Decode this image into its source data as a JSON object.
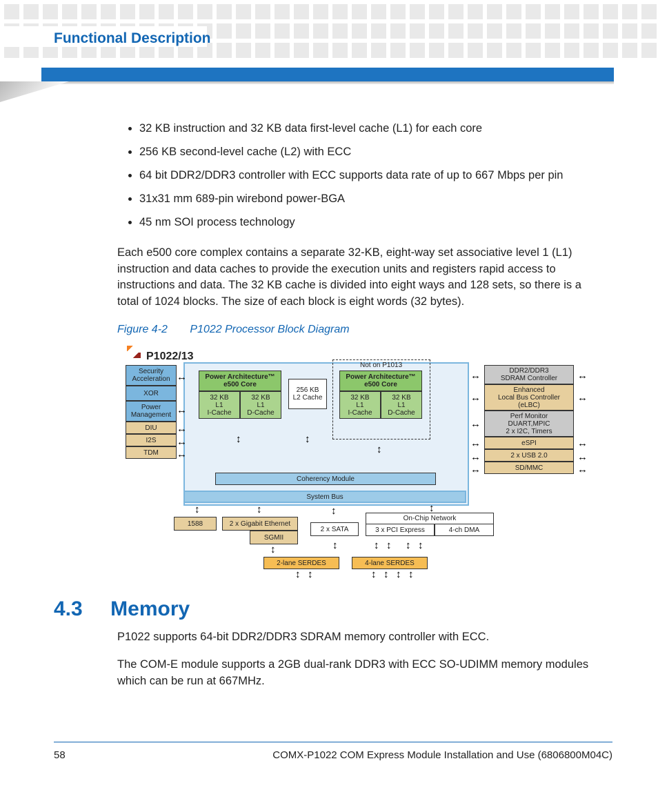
{
  "header": {
    "chapter_title": "Functional Description"
  },
  "bullets": [
    "32 KB instruction and 32 KB data first-level cache (L1) for each core",
    "256 KB second-level cache (L2) with ECC",
    "64 bit DDR2/DDR3 controller with ECC supports data rate of up to 667 Mbps per pin",
    "31x31 mm 689-pin wirebond power-BGA",
    "45 nm SOI process technology"
  ],
  "paragraph1": "Each e500 core complex contains a separate 32-KB, eight-way set associative level 1 (L1) instruction and data caches to provide the execution units and registers rapid access to instructions and data. The 32 KB cache is divided into eight ways and 128 sets, so there is a total of 1024 blocks. The size of each block is eight words (32 bytes).",
  "figure": {
    "num": "Figure 4-2",
    "caption": "P1022 Processor Block Diagram"
  },
  "diagram": {
    "chip": "P1022/13",
    "left_blocks": [
      "Security\nAcceleration",
      "XOR",
      "Power\nManagement",
      "DIU",
      "I2S",
      "TDM"
    ],
    "core_title": "Power Architecture™\ne500 Core",
    "icache": "32 KB\nL1\nI-Cache",
    "dcache": "32 KB\nL1\nD-Cache",
    "l2": "256 KB\nL2 Cache",
    "not_on": "Not on P1013",
    "coherency": "Coherency Module",
    "system_bus": "System Bus",
    "right_blocks": [
      "DDR2/DDR3\nSDRAM Controller",
      "Enhanced\nLocal Bus Controller\n(eLBC)",
      "Perf Monitor\nDUART,MPIC\n2 x I2C, Timers",
      "eSPI",
      "2 x USB 2.0",
      "SD/MMC"
    ],
    "bottom_tan": [
      "1588",
      "2 x Gigabit Ethernet",
      "SGMII"
    ],
    "bottom_white": [
      "2 x SATA",
      "3 x PCI Express",
      "4-ch DMA"
    ],
    "onchip": "On-Chip Network",
    "serdes2": "2-lane SERDES",
    "serdes4": "4-lane SERDES"
  },
  "section": {
    "num": "4.3",
    "title": "Memory"
  },
  "paragraph2": "P1022 supports 64-bit DDR2/DDR3 SDRAM memory controller with ECC.",
  "paragraph3": "The COM-E module supports a 2GB dual-rank DDR3 with ECC SO-UDIMM memory modules which can be run at 667MHz.",
  "footer": {
    "page": "58",
    "doc": "COMX-P1022 COM Express Module Installation and Use (6806800M04C)"
  }
}
